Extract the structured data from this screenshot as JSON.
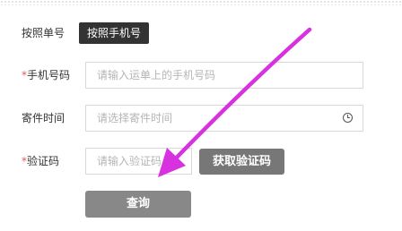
{
  "tabs": {
    "by_order": "按照单号",
    "by_phone": "按照手机号"
  },
  "form": {
    "phone": {
      "required_mark": "*",
      "label": "手机号码",
      "placeholder": "请输入运单上的手机号码"
    },
    "time": {
      "label": "寄件时间",
      "placeholder": "请选择寄件时间",
      "icon": "clock-icon"
    },
    "code": {
      "required_mark": "*",
      "label": "验证码",
      "placeholder": "请输入验证码",
      "get_code_label": "获取验证码"
    },
    "query_label": "查询"
  },
  "colors": {
    "active_tab_bg": "#333333",
    "required_mark": "#e05a5a",
    "button_gray": "#777777",
    "arrow": "#d831e0"
  }
}
